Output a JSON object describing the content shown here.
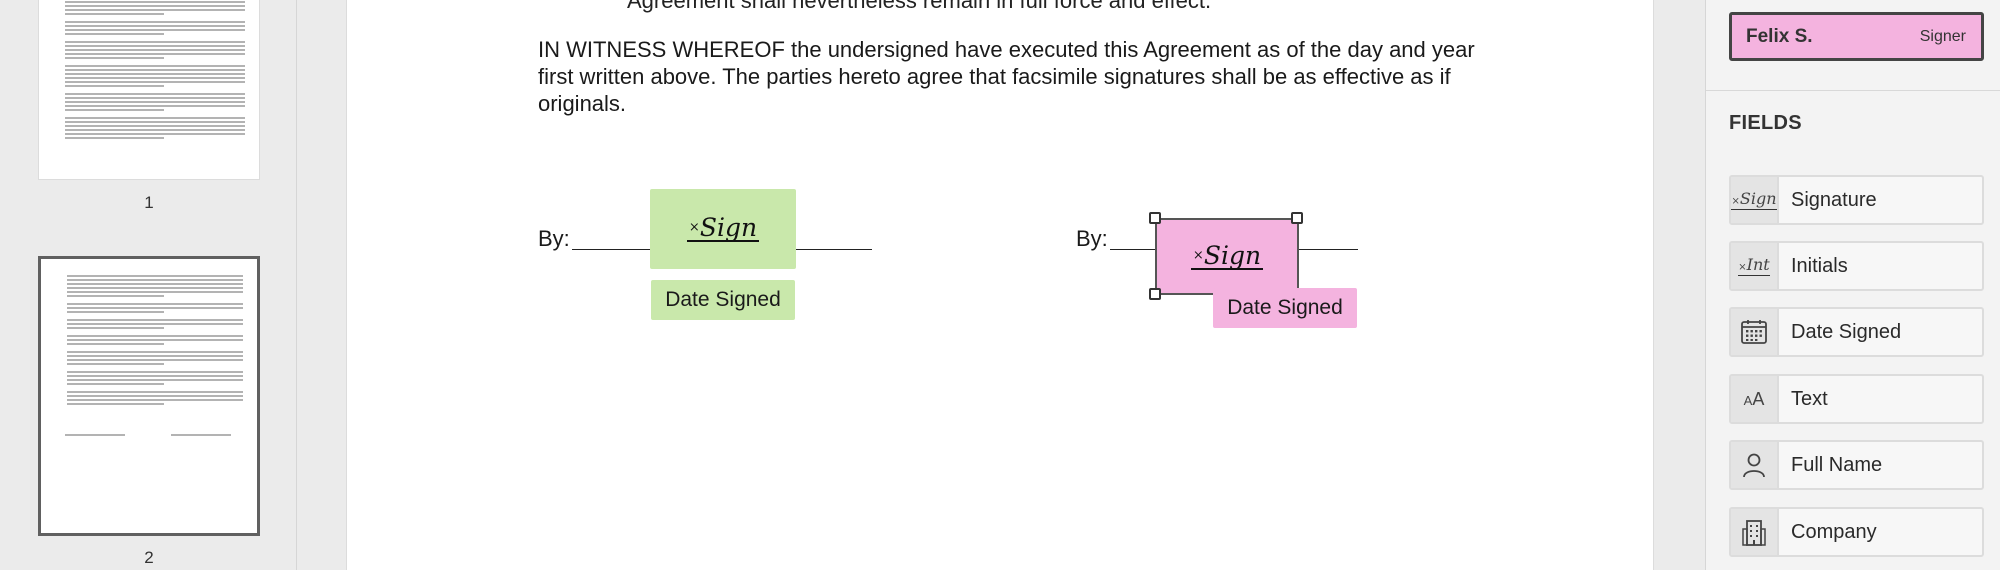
{
  "thumbnails": [
    {
      "number": "1"
    },
    {
      "number": "2"
    }
  ],
  "document": {
    "clipped_text": "Agreement shall nevertheless remain in full force and effect.",
    "witness_paragraph": "IN WITNESS WHEREOF the undersigned have executed this Agreement as of the day and year first written above.  The parties hereto agree that facsimile signatures shall be as effective as if originals.",
    "by_label": "By:",
    "signature_mark": "Sign",
    "signature_prefix": "×",
    "date_signed_label": "Date Signed"
  },
  "panel": {
    "signer": {
      "name": "Felix S.",
      "role": "Signer",
      "color": "#f4b3df"
    },
    "fields_heading": "FIELDS",
    "fields": [
      {
        "label": "Signature",
        "icon": "signature-icon"
      },
      {
        "label": "Initials",
        "icon": "initials-icon"
      },
      {
        "label": "Date Signed",
        "icon": "calendar-icon"
      },
      {
        "label": "Text",
        "icon": "text-icon"
      },
      {
        "label": "Full Name",
        "icon": "person-icon"
      },
      {
        "label": "Company",
        "icon": "building-icon"
      }
    ],
    "icon_glyphs": {
      "signature": "Sign",
      "initials": "Int",
      "text_small": "A",
      "text_large": "A"
    }
  },
  "colors": {
    "signer_a": "#c9e8ab",
    "signer_b": "#f4b3df"
  }
}
